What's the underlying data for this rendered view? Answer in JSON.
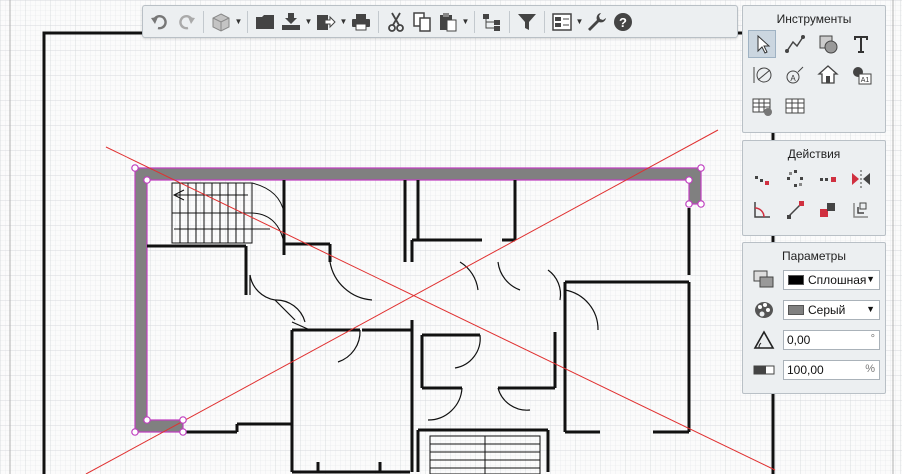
{
  "toolbar": {
    "buttons": [
      {
        "name": "undo-button",
        "icon": "undo-icon"
      },
      {
        "name": "redo-button",
        "icon": "redo-icon"
      },
      {
        "name": "view-3d-button",
        "icon": "cube-icon"
      },
      {
        "name": "open-button",
        "icon": "folder-icon"
      },
      {
        "name": "import-button",
        "icon": "import-icon"
      },
      {
        "name": "export-button",
        "icon": "export-icon"
      },
      {
        "name": "print-button",
        "icon": "printer-icon"
      },
      {
        "name": "cut-button",
        "icon": "scissors-icon"
      },
      {
        "name": "copy-button",
        "icon": "copy-icon"
      },
      {
        "name": "paste-button",
        "icon": "paste-icon"
      },
      {
        "name": "hierarchy-button",
        "icon": "hierarchy-icon"
      },
      {
        "name": "filter-button",
        "icon": "filter-icon"
      },
      {
        "name": "layers-button",
        "icon": "layers-icon"
      },
      {
        "name": "settings-button",
        "icon": "wrench-icon"
      },
      {
        "name": "help-button",
        "icon": "help-icon"
      }
    ]
  },
  "panels": {
    "tools": {
      "title": "Инструменты"
    },
    "actions": {
      "title": "Действия"
    },
    "params": {
      "title": "Параметры",
      "line_style": "Сплошная",
      "line_style_color": "#000000",
      "fill": "Серый",
      "fill_color": "#808080",
      "angle": "0,00",
      "angle_unit": "°",
      "scale": "100,00",
      "scale_unit": "%"
    }
  },
  "colors": {
    "selection": "#c040c0",
    "wall_fill": "#808080",
    "guide_line": "#e03030"
  }
}
